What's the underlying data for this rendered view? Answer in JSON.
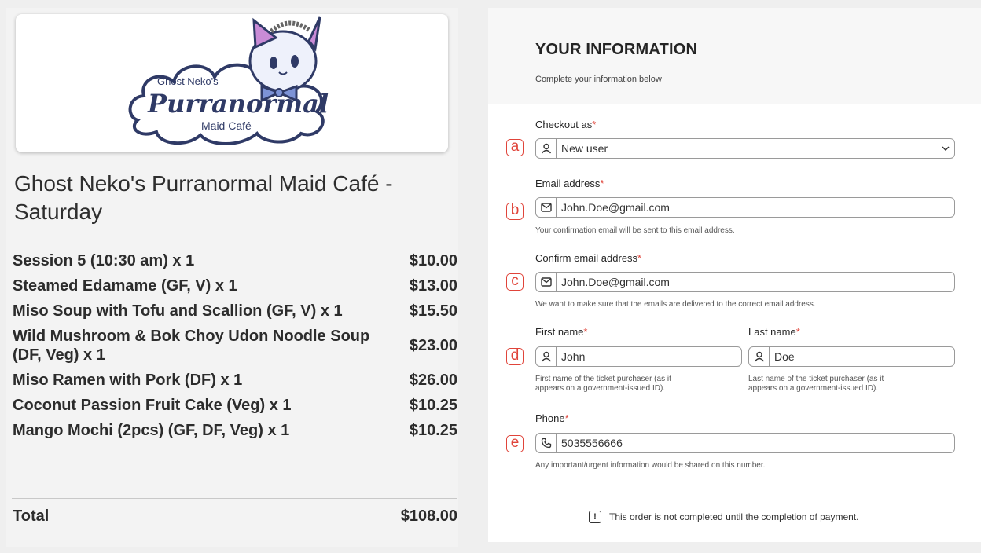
{
  "order_summary": {
    "logo": {
      "top_text": "Ghost Neko's",
      "main_text": "Purranormal",
      "bottom_text": "Maid Café"
    },
    "event_title": "Ghost Neko's Purranormal Maid Café - Saturday",
    "items": [
      {
        "name": "Session 5 (10:30 am) x 1",
        "price": "$10.00"
      },
      {
        "name": "Steamed Edamame (GF, V) x 1",
        "price": "$13.00"
      },
      {
        "name": "Miso Soup with Tofu and Scallion (GF, V) x 1",
        "price": "$15.50"
      },
      {
        "name": "Wild Mushroom & Bok Choy Udon Noodle Soup (DF, Veg) x 1",
        "price": "$23.00"
      },
      {
        "name": "Miso Ramen with Pork (DF) x 1",
        "price": "$26.00"
      },
      {
        "name": "Coconut Passion Fruit Cake (Veg)  x 1",
        "price": "$10.25"
      },
      {
        "name": "Mango Mochi (2pcs) (GF, DF, Veg) x 1",
        "price": "$10.25"
      }
    ],
    "total_label": "Total",
    "total_value": "$108.00"
  },
  "form": {
    "title": "YOUR INFORMATION",
    "subtitle": "Complete your information below",
    "required_mark": "*",
    "checkout_as": {
      "label": "Checkout as",
      "value": "New user",
      "icon": "user-icon",
      "marker": "a"
    },
    "email": {
      "label": "Email address",
      "value": "John.Doe@gmail.com",
      "icon": "mail-icon",
      "hint": "Your confirmation email will be sent to this email address.",
      "marker": "b"
    },
    "confirm_email": {
      "label": "Confirm email address",
      "value": "John.Doe@gmail.com",
      "icon": "mail-icon",
      "hint": "We want to make sure that the emails are delivered to the correct email address.",
      "marker": "c"
    },
    "first_name": {
      "label": "First name",
      "value": "John",
      "icon": "user-icon",
      "hint_line1": "First name of the ticket purchaser (as it",
      "hint_line2": "appears on a government-issued ID).",
      "marker": "d"
    },
    "last_name": {
      "label": "Last name",
      "value": "Doe",
      "icon": "user-icon",
      "hint_line1": "Last name of the ticket purchaser (as it",
      "hint_line2": "appears on a government-issued ID)."
    },
    "phone": {
      "label": "Phone",
      "value": "5035556666",
      "icon": "phone-icon",
      "hint": "Any important/urgent information would be shared on this number.",
      "marker": "e"
    },
    "notice": "This order is not completed until the completion of payment.",
    "notice_icon_glyph": "!"
  },
  "colors": {
    "required": "#e0443a",
    "marker": "#e0443a",
    "background": "#efefef"
  }
}
